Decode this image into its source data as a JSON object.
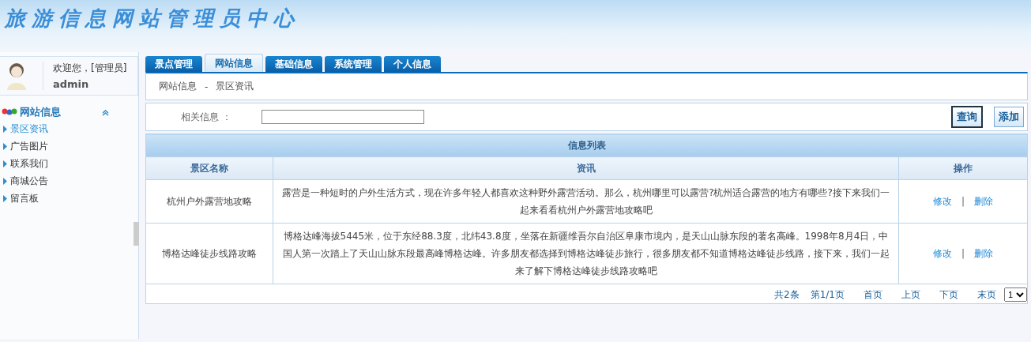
{
  "header": {
    "title": "旅游信息网站管理员中心"
  },
  "user": {
    "greeting": "欢迎您，[管理员]",
    "name": "admin"
  },
  "sidebar": {
    "title": "网站信息",
    "expanded": true,
    "items": [
      {
        "label": "景区资讯",
        "selected": true
      },
      {
        "label": "广告图片",
        "selected": false
      },
      {
        "label": "联系我们",
        "selected": false
      },
      {
        "label": "商城公告",
        "selected": false
      },
      {
        "label": "留言板",
        "selected": false
      }
    ]
  },
  "tabs": [
    {
      "label": "景点管理",
      "selected": false
    },
    {
      "label": "网站信息",
      "selected": true
    },
    {
      "label": "基础信息",
      "selected": false
    },
    {
      "label": "系统管理",
      "selected": false
    },
    {
      "label": "个人信息",
      "selected": false
    }
  ],
  "breadcrumb": [
    "网站信息",
    "-",
    "景区资讯"
  ],
  "search": {
    "label": "相关信息 ：",
    "buttons": [
      "查询",
      "添加"
    ]
  },
  "table": {
    "title": "信息列表",
    "columns": [
      "景区名称",
      "资讯",
      "操作"
    ],
    "rows": [
      {
        "name": "杭州户外露营地攻略",
        "content": "露营是一种短时的户外生活方式，现在许多年轻人都喜欢这种野外露营活动。那么，杭州哪里可以露营?杭州适合露营的地方有哪些?接下来我们一起来看看杭州户外露营地攻略吧",
        "actions": [
          "修改",
          "|",
          "删除"
        ]
      },
      {
        "name": "博格达峰徒步线路攻略",
        "content": "博格达峰海拔5445米，位于东经88.3度，北纬43.8度，坐落在新疆维吾尔自治区阜康市境内，是天山山脉东段的著名高峰。1998年8月4日，中国人第一次踏上了天山山脉东段最高峰博格达峰。许多朋友都选择到博格达峰徒步旅行，很多朋友都不知道博格达峰徒步线路，接下来，我们一起来了解下博格达峰徒步线路攻略吧",
        "actions": [
          "修改",
          "|",
          "删除"
        ]
      }
    ]
  },
  "pager": {
    "total": "共2条",
    "page": "第1/1页",
    "links": [
      "首页",
      "上页",
      "下页",
      "末页"
    ],
    "select": "1"
  }
}
